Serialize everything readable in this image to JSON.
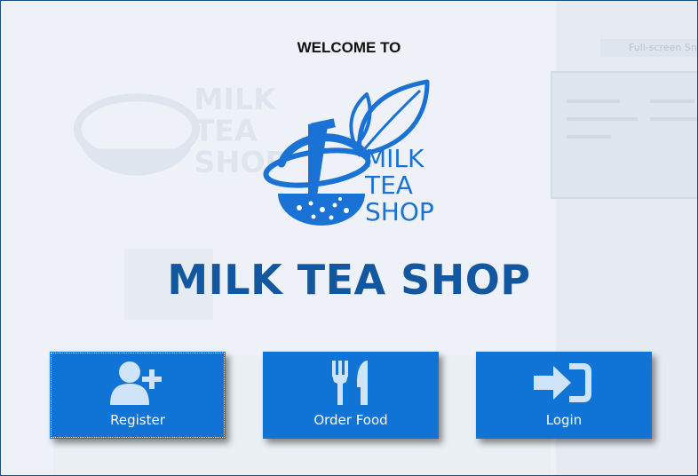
{
  "background": {
    "overlay_label": "Full-screen Sni"
  },
  "welcome_text": "WELCOME TO",
  "logo": {
    "lines": [
      "MILK",
      "TEA",
      "SHOP"
    ],
    "color": "#1a73d4"
  },
  "shop_title": "MILK TEA SHOP",
  "buttons": [
    {
      "label": "Register",
      "icon": "user-add-icon"
    },
    {
      "label": "Order Food",
      "icon": "fork-knife-icon"
    },
    {
      "label": "Login",
      "icon": "sign-in-icon"
    }
  ],
  "colors": {
    "tile": "#0f74d6",
    "title": "#1357a0",
    "frame": "#1a4f86"
  }
}
